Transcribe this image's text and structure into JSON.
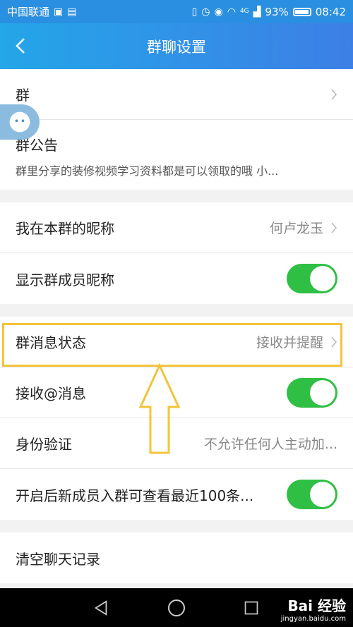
{
  "status_bar": {
    "carrier": "中国联通",
    "network": "4G",
    "battery": "93%",
    "time": "08:42"
  },
  "header": {
    "title": "群聊设置"
  },
  "rows": {
    "group_name_label": "群",
    "announcement_label": "群公告",
    "announcement_text": "群里分享的装修视频学习资料都是可以领取的哦 小...",
    "nickname_label": "我在本群的昵称",
    "nickname_value": "何卢龙玉",
    "show_nick_label": "显示群成员昵称",
    "show_nick_on": true,
    "msg_status_label": "群消息状态",
    "msg_status_value": "接收并提醒",
    "receive_at_label": "接收@消息",
    "receive_at_on": true,
    "verify_label": "身份验证",
    "verify_value": "不允许任何人主动加...",
    "history_label": "开启后新成员入群可查看最近100条...",
    "history_on": true,
    "clear_label": "清空聊天记录"
  },
  "watermark": {
    "brand": "Bai 经验",
    "url": "jingyan.baidu.com"
  },
  "colors": {
    "accent": "#2fbf44",
    "header": "#2a8fe0",
    "highlight": "#f3c43a"
  }
}
